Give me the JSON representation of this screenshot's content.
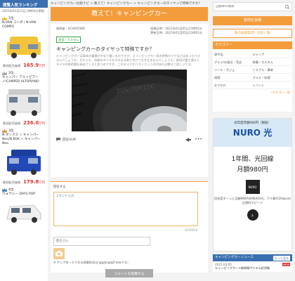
{
  "ranking": {
    "title": "閲覧人気ランキング",
    "date": "2021年01月12日 0時00分更新",
    "items": [
      {
        "rank": "1位",
        "name": "N-VAN コンポ / N-VAN COMPO",
        "price_label": "最低販売価格",
        "price": "165.9",
        "unit": "万円",
        "color": "#f2b52b"
      },
      {
        "rank": "2位",
        "name": "キャンパー アルトピアー ノ/CAMPER ALTOPIANO",
        "price_label": "最低販売価格",
        "price": "236.0",
        "unit": "万円",
        "color": "#999"
      },
      {
        "rank": "3位",
        "name": "N ボックス + キャンパー Neo/N BOX + キャンパー Neo",
        "price_label": "最低販売価格",
        "price": "179.8",
        "unit": "万円",
        "color": "#c98a3a"
      },
      {
        "rank": "4位",
        "name": "ウォウシー DAYS POP",
        "price_label": "",
        "price": "",
        "unit": "",
        "color": "#3a6fb0"
      }
    ]
  },
  "breadcrumb": "キャンピングカー比較ナビ > 教えて！キャンピングカー > キャンピングカーのタイヤって特殊ですか？",
  "page_title": "教えて！キャンピングカー",
  "post": {
    "author": "質問者｜SCHAS5WD",
    "posted": "投稿日時：2021年01月05日11時01分",
    "updated": "更新日時：2021年01月05日11時01分",
    "tag": "改造・カスタム",
    "question": "キャンピングカーのタイヤって特殊ですか？",
    "body": "キャンピングカーは車体の重量がかなり重いものですが、キャンピングカー用の特殊タイヤなどはあったりするんでしょうか。それとも、市販のタイヤをそのまま取り付けても大丈夫なんでしょうか。普段が重さ通るとタイヤの負荷量を高めてくると思うのですが、このタイヤがベストというのがあれば教えて欲しいです。",
    "reply_count": "回答(0)件",
    "share_icon": "share-icon",
    "more_icon": "more-icon"
  },
  "reply": {
    "label": "回答する",
    "placeholder": "コメント入力",
    "counter": "0/1000字",
    "name_placeholder": "匿名さん",
    "upload_note": "※ アップロードできる画像形式は jpg/png/gif のみです。",
    "submit": "コメントを投稿する"
  },
  "sidebar": {
    "search_placeholder": "自動車の検索",
    "post_button": "質問を投稿",
    "recent_button": "私の投稿質問・回答一覧",
    "category_title": "カテゴリー",
    "categories": [
      "車中泊",
      "キャンプ",
      "グルメ/お風呂・売店",
      "装備・カスタム",
      "ツール・ガジェ",
      "トラブル・事故",
      "保険",
      "グルメ・料理",
      "おでかけ",
      "イベント"
    ],
    "more": "→カテゴリ一覧"
  },
  "ad": {
    "top_line": "初年度月額980円（税抜）",
    "brand": "NURO 光",
    "main1": "1年間、光回線",
    "main2": "月額980円",
    "logo": "NURO",
    "desc": "回年度ずーっと月額980円のNURO光、下り最大2Gbpsの圧倒的スピード",
    "arrow": "›"
  },
  "news": {
    "title": "キャンピングカーニュース",
    "more": "もっと見る",
    "date": "2021.03.05",
    "badge": "NEW",
    "text": "キャンピングカー×新幹線アイテム好評新"
  }
}
